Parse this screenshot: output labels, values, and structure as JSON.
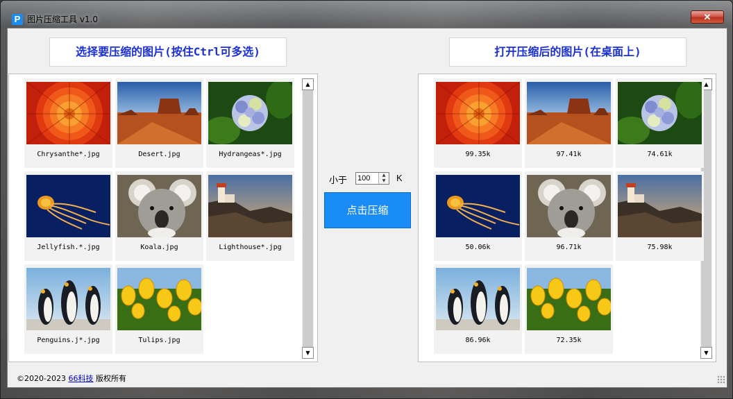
{
  "window": {
    "title": "图片压缩工具 v1.0",
    "app_icon": "P",
    "close_label": "✕"
  },
  "left_panel": {
    "header": "选择要压缩的图片(按住Ctrl可多选)",
    "items": [
      {
        "name": "Chrysanthe*.jpg",
        "image": "chrysanthemum"
      },
      {
        "name": "Desert.jpg",
        "image": "desert"
      },
      {
        "name": "Hydrangeas*.jpg",
        "image": "hydrangeas"
      },
      {
        "name": "Jellyfish.*.jpg",
        "image": "jellyfish"
      },
      {
        "name": "Koala.jpg",
        "image": "koala"
      },
      {
        "name": "Lighthouse*.jpg",
        "image": "lighthouse"
      },
      {
        "name": "Penguins.j*.jpg",
        "image": "penguins"
      },
      {
        "name": "Tulips.jpg",
        "image": "tulips"
      }
    ]
  },
  "controls": {
    "less_than_label": "小于",
    "size_value": "100",
    "unit_label": "K",
    "compress_button": "点击压缩"
  },
  "right_panel": {
    "header": "打开压缩后的图片(在桌面上)",
    "items": [
      {
        "size": "99.35k",
        "image": "chrysanthemum"
      },
      {
        "size": "97.41k",
        "image": "desert"
      },
      {
        "size": "74.61k",
        "image": "hydrangeas"
      },
      {
        "size": "50.06k",
        "image": "jellyfish"
      },
      {
        "size": "96.71k",
        "image": "koala"
      },
      {
        "size": "75.98k",
        "image": "lighthouse"
      },
      {
        "size": "86.96k",
        "image": "penguins"
      },
      {
        "size": "72.35k",
        "image": "tulips"
      }
    ]
  },
  "footer": {
    "copyright": "©2020-2023",
    "company_link": "66科技",
    "rights": "版权所有"
  }
}
